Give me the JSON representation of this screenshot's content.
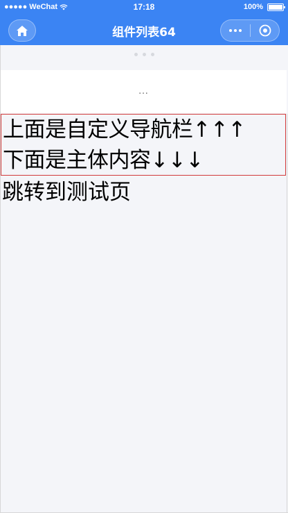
{
  "status_bar": {
    "carrier": "●●●●● WeChat",
    "time": "17:18",
    "battery": "100%"
  },
  "nav_bar": {
    "title": "组件列表64"
  },
  "custom_nav": {
    "ellipsis": "..."
  },
  "main": {
    "line_up": "上面是自定义导航栏↑↑↑",
    "line_down": "下面是主体内容↓↓↓",
    "jump_link": "跳转到测试页"
  },
  "colors": {
    "brand": "#3b84f3",
    "background": "#f4f5f9",
    "box_border": "#d13a3a"
  },
  "icons": {
    "home": "home-icon",
    "more": "more-dots-icon",
    "close": "target-circle-icon",
    "wifi": "wifi-icon",
    "battery": "battery-icon"
  }
}
